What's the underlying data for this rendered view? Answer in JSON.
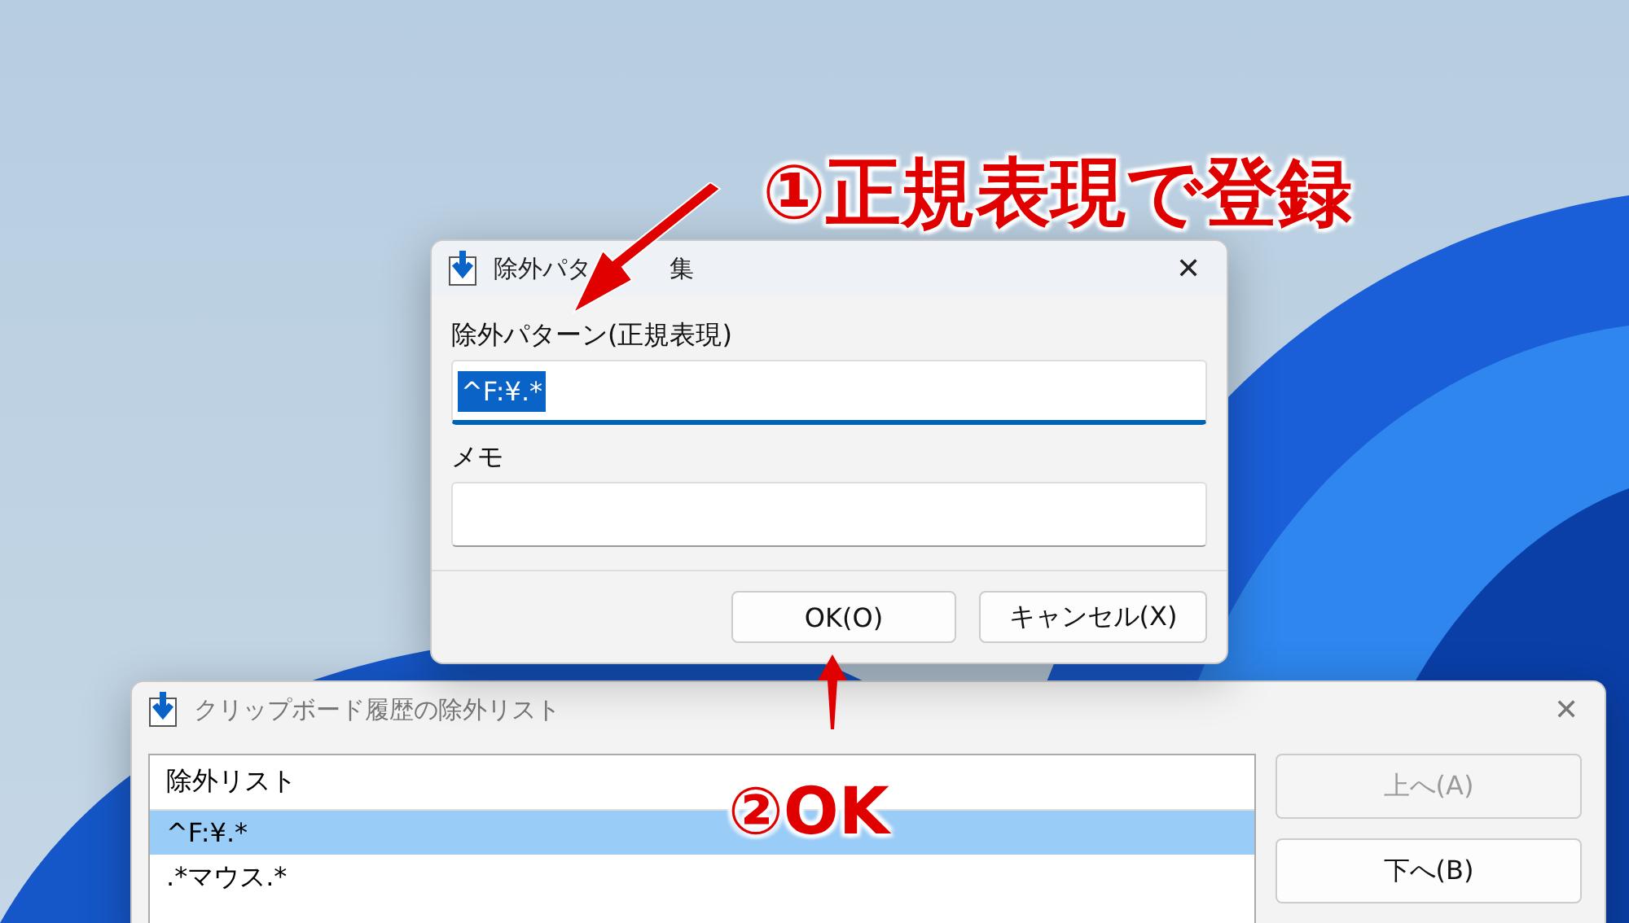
{
  "annotations": [
    {
      "kind": "callout",
      "text": "①正規表現で登録"
    },
    {
      "kind": "callout",
      "text": "②OK"
    }
  ],
  "edit_dialog": {
    "title_parts": [
      "除外パタ",
      "集"
    ],
    "close": "✕",
    "pattern_label": "除外パターン(正規表現)",
    "pattern_value": "^F:¥.*",
    "pattern_selected": true,
    "memo_label": "メモ",
    "buttons": [
      {
        "label": "OK(O)",
        "disabled": false
      },
      {
        "label": "キャンセル(X)",
        "disabled": false
      }
    ]
  },
  "list_window": {
    "title": "クリップボード履歴の除外リスト",
    "close": "✕",
    "list_header": "除外リスト",
    "rows": [
      {
        "text": "^F:¥.*",
        "selected": true
      },
      {
        "text": ".*マウス.*",
        "selected": false
      }
    ],
    "buttons": [
      {
        "label": "上へ(A)",
        "disabled": true
      },
      {
        "label": "下へ(B)",
        "disabled": false
      }
    ]
  }
}
